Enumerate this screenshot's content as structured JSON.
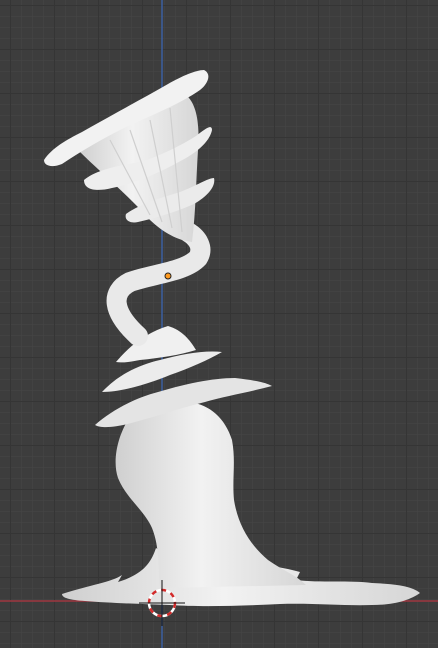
{
  "viewport": {
    "background_color": "#3d3d3d",
    "grid_major_color": "#353535",
    "grid_minor_color": "#464646",
    "axis_x_color": "#a03640",
    "axis_z_color": "#3b5fa0",
    "origin_color": "#ff9a1f",
    "cursor_colors": [
      "#ffffff",
      "#d22a2a"
    ]
  },
  "model": {
    "name_icon": "sculpted-tree-mesh",
    "color": "#ebebeb"
  }
}
